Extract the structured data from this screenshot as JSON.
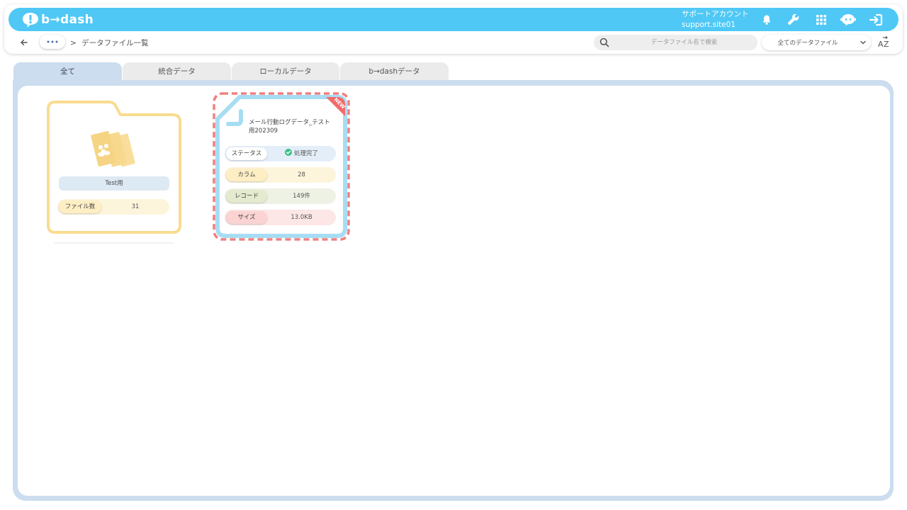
{
  "app": {
    "logo_text": "b→dash"
  },
  "account": {
    "name": "サポートアカウント",
    "site": "support.site01"
  },
  "header_icons": [
    "bell-icon",
    "wrench-icon",
    "grid-icon",
    "chat-bot-icon",
    "logout-icon"
  ],
  "breadcrumb": {
    "separator": ">",
    "current": "データファイル一覧"
  },
  "search": {
    "placeholder": "データファイル名で検索",
    "value": ""
  },
  "filter": {
    "selected": "全てのデータファイル"
  },
  "tabs": [
    {
      "label": "全て",
      "active": true
    },
    {
      "label": "統合データ",
      "active": false
    },
    {
      "label": "ローカルデータ",
      "active": false
    },
    {
      "label": "b→dashデータ",
      "active": false
    }
  ],
  "folder": {
    "name": "Test用",
    "count_label": "ファイル数",
    "count_value": "31"
  },
  "file": {
    "title": "メール行動ログデータ_テスト用202309",
    "badge": "NEW",
    "rows": [
      {
        "label": "ステータス",
        "value": "処理完了"
      },
      {
        "label": "カラム",
        "value": "28"
      },
      {
        "label": "レコード",
        "value": "149件"
      },
      {
        "label": "サイズ",
        "value": "13.0KB"
      }
    ]
  },
  "colors": {
    "brand": "#4fc8f5",
    "folder": "#f8dc8f",
    "file_border": "#a7ddf3",
    "highlight_dash": "#f08080",
    "status_ok": "#3cc08a"
  }
}
